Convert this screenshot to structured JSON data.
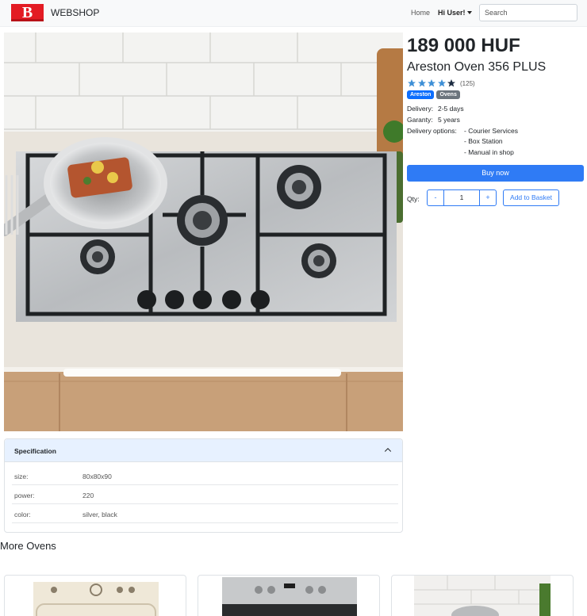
{
  "navbar": {
    "logo_letter": "B",
    "brand": "WEBSHOP",
    "home": "Home",
    "user": "Hi User!",
    "search_placeholder": "Search"
  },
  "product": {
    "price": "189 000 HUF",
    "title": "Areston Oven 356 PLUS",
    "rating": 4.5,
    "rating_max": 5,
    "reviews": "(125)",
    "badges": [
      "Areston",
      "Ovens"
    ],
    "delivery_label": "Delivery:",
    "delivery_value": "2-5 days",
    "garanty_label": "Garanty:",
    "garanty_value": "5 years",
    "delivery_options_label": "Delivery options:",
    "delivery_options": [
      "- Courier Services",
      "- Box Station",
      "- Manual in shop"
    ],
    "buy_now": "Buy now",
    "qty_label": "Qty:",
    "qty_minus": "-",
    "qty_value": "1",
    "qty_plus": "+",
    "add_to_basket": "Add to Basket"
  },
  "specification": {
    "title": "Specification",
    "rows": [
      {
        "key": "size:",
        "value": "80x80x90"
      },
      {
        "key": "power:",
        "value": "220"
      },
      {
        "key": "color:",
        "value": "silver, black"
      }
    ]
  },
  "more": {
    "title": "More Ovens"
  },
  "colors": {
    "primary": "#2f7bf5",
    "logo_red": "#e31b23",
    "star_blue": "#3d8fd6",
    "spec_header": "#e7f1ff"
  }
}
